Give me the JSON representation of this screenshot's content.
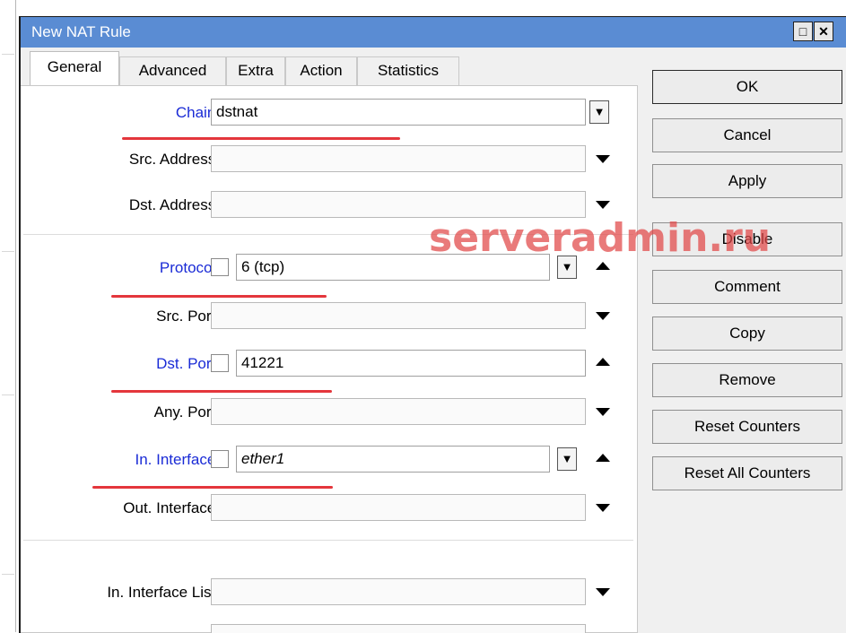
{
  "window": {
    "title": "New NAT Rule",
    "restore_icon": "□",
    "close_icon": "✕"
  },
  "tabs": [
    {
      "label": "General",
      "active": true
    },
    {
      "label": "Advanced",
      "active": false
    },
    {
      "label": "Extra",
      "active": false
    },
    {
      "label": "Action",
      "active": false
    },
    {
      "label": "Statistics",
      "active": false
    }
  ],
  "fields": {
    "chain": {
      "label": "Chain:",
      "value": "dstnat"
    },
    "src_address": {
      "label": "Src. Address:",
      "value": ""
    },
    "dst_address": {
      "label": "Dst. Address:",
      "value": ""
    },
    "protocol": {
      "label": "Protocol:",
      "value": "6 (tcp)"
    },
    "src_port": {
      "label": "Src. Port:",
      "value": ""
    },
    "dst_port": {
      "label": "Dst. Port:",
      "value": "41221"
    },
    "any_port": {
      "label": "Any. Port:",
      "value": ""
    },
    "in_interface": {
      "label": "In. Interface:",
      "value": "ether1"
    },
    "out_interface": {
      "label": "Out. Interface:",
      "value": ""
    },
    "in_interface_list": {
      "label": "In. Interface List:",
      "value": ""
    }
  },
  "buttons": {
    "ok": "OK",
    "cancel": "Cancel",
    "apply": "Apply",
    "disable": "Disable",
    "comment": "Comment",
    "copy": "Copy",
    "remove": "Remove",
    "reset_counters": "Reset Counters",
    "reset_all_counters": "Reset All Counters"
  },
  "watermark": "serveradmin.ru",
  "colors": {
    "titlebar": "#5a8cd3",
    "label_highlight": "#1a2bd6",
    "annotation_red": "#e4363c"
  }
}
